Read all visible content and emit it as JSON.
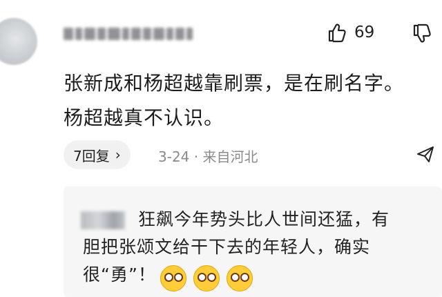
{
  "comment": {
    "like_count": "69",
    "text_line1": "张新成和杨超越靠刷票，是在刷名字。",
    "text_line2": "杨超越真不认识。",
    "reply_label": "7回复",
    "reply_chevron": "›",
    "meta": "3-24 · 来自河北",
    "icons": {
      "like": "thumbs-up-icon",
      "dislike": "thumbs-down-icon",
      "share": "share-icon"
    }
  },
  "quoted_reply": {
    "line1": "狂飙今年势头比人世间还猛，有",
    "line2": "胆把张颂文给干下去的年轻人，确实",
    "line3": "很“勇”！",
    "emoji": [
      "wow-face-emoji",
      "wow-face-emoji",
      "wow-face-emoji"
    ]
  }
}
